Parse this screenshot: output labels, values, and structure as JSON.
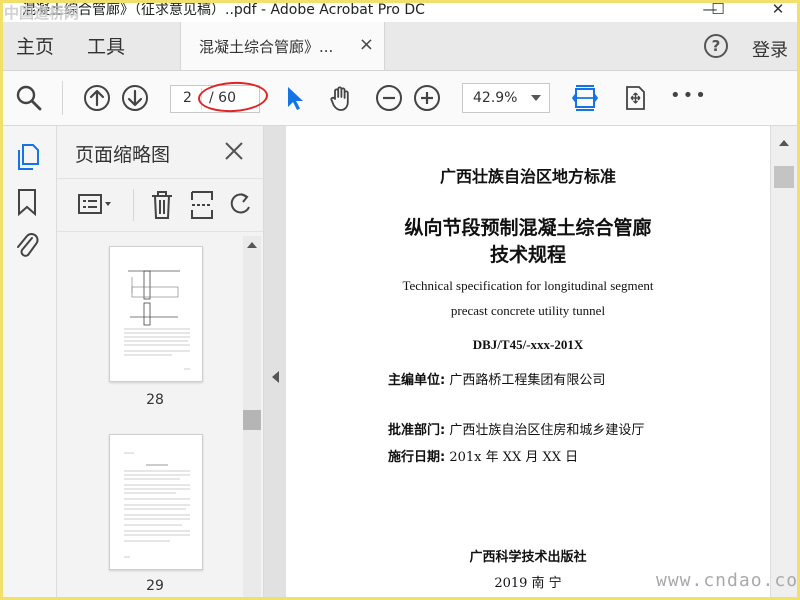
{
  "window": {
    "title": "混凝土综合管廊》（征求意见稿）..pdf - Adobe Acrobat Pro DC",
    "watermark_top_left": "中国道桥网",
    "minimize_label": "—",
    "maximize_label": "☐",
    "close_label": "✕"
  },
  "tabs": {
    "home_label": "主页",
    "tools_label": "工具",
    "doc_tab_label": "混凝土综合管廊》...",
    "doc_tab_close": "×",
    "help_label": "?",
    "login_label": "登录"
  },
  "toolbar": {
    "page_current": "2",
    "page_total": "/ 60",
    "zoom_value": "42.9%",
    "more_label": "•••"
  },
  "thumbnails": {
    "pane_title": "页面缩略图",
    "pages": [
      {
        "number": "28"
      },
      {
        "number": "29"
      }
    ]
  },
  "document": {
    "line1": "广西壮族自治区地方标准",
    "line2": "纵向节段预制混凝土综合管廊",
    "line3": "技术规程",
    "en_line1": "Technical specification for longitudinal segment",
    "en_line2": "precast concrete utility tunnel",
    "code": "DBJ/T45/-xxx-201X",
    "editor_label": "主编单位:",
    "editor_value": "广西路桥工程集团有限公司",
    "approver_label": "批准部门:",
    "approver_value": "广西壮族自治区住房和城乡建设厅",
    "date_label": "施行日期:",
    "date_value": "201x 年 XX 月 XX 日",
    "publisher": "广西科学技术出版社",
    "pub_place": "2019  南  宁"
  },
  "watermark_bottom_right": "www.cndao.com",
  "colors": {
    "accent_blue": "#1473e6",
    "annotation_red": "#e02424",
    "frame_yellow": "#f3e06a"
  }
}
